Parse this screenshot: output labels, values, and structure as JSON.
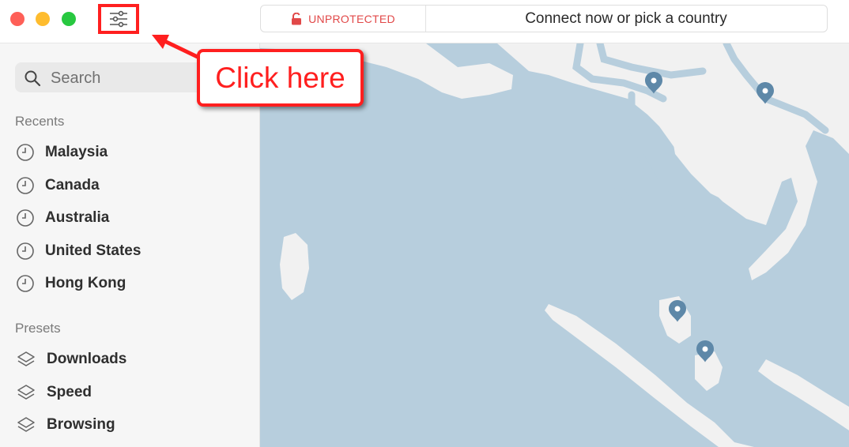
{
  "titlebar": {
    "status_label": "UNPROTECTED",
    "connect_label": "Connect now or pick a country",
    "status_color": "#e14848"
  },
  "sidebar": {
    "search_placeholder": "Search",
    "recents_heading": "Recents",
    "recents": [
      {
        "label": "Malaysia",
        "icon": "clock-icon"
      },
      {
        "label": "Canada",
        "icon": "clock-icon"
      },
      {
        "label": "Australia",
        "icon": "clock-icon"
      },
      {
        "label": "United States",
        "icon": "clock-icon"
      },
      {
        "label": "Hong Kong",
        "icon": "clock-icon"
      }
    ],
    "presets_heading": "Presets",
    "presets": [
      {
        "label": "Downloads",
        "icon": "layers-icon"
      },
      {
        "label": "Speed",
        "icon": "layers-icon"
      },
      {
        "label": "Browsing",
        "icon": "layers-icon"
      }
    ]
  },
  "annotation": {
    "callout_text": "Click here",
    "color": "#ff1f1f"
  },
  "map": {
    "water_color": "#b7cedd",
    "land_color": "#f1f1f1",
    "pin_color": "#5e88a8"
  }
}
